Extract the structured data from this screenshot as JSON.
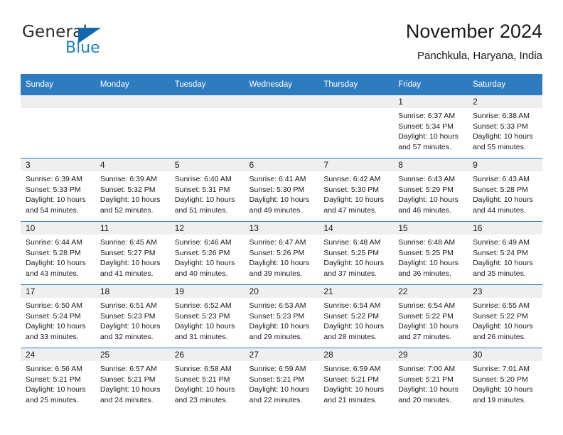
{
  "brand": {
    "name_part1": "General",
    "name_part2": "Blue",
    "accent_color": "#1f7fc4",
    "triangle_color": "#1168ad"
  },
  "header": {
    "title": "November 2024",
    "subtitle": "Panchkula, Haryana, India"
  },
  "theme": {
    "header_row_bg": "#2e7cbf",
    "daynum_bg": "#efefef",
    "cell_bg": "#ffffff",
    "text_color": "#1a1a1a"
  },
  "weekdays": [
    "Sunday",
    "Monday",
    "Tuesday",
    "Wednesday",
    "Thursday",
    "Friday",
    "Saturday"
  ],
  "labels": {
    "sunrise_prefix": "Sunrise: ",
    "sunset_prefix": "Sunset: ",
    "daylight_prefix": "Daylight: "
  },
  "weeks": [
    [
      {
        "day": "",
        "empty": true
      },
      {
        "day": "",
        "empty": true
      },
      {
        "day": "",
        "empty": true
      },
      {
        "day": "",
        "empty": true
      },
      {
        "day": "",
        "empty": true
      },
      {
        "day": "1",
        "sunrise": "Sunrise: 6:37 AM",
        "sunset": "Sunset: 5:34 PM",
        "daylight": "Daylight: 10 hours and 57 minutes."
      },
      {
        "day": "2",
        "sunrise": "Sunrise: 6:38 AM",
        "sunset": "Sunset: 5:33 PM",
        "daylight": "Daylight: 10 hours and 55 minutes."
      }
    ],
    [
      {
        "day": "3",
        "sunrise": "Sunrise: 6:39 AM",
        "sunset": "Sunset: 5:33 PM",
        "daylight": "Daylight: 10 hours and 54 minutes."
      },
      {
        "day": "4",
        "sunrise": "Sunrise: 6:39 AM",
        "sunset": "Sunset: 5:32 PM",
        "daylight": "Daylight: 10 hours and 52 minutes."
      },
      {
        "day": "5",
        "sunrise": "Sunrise: 6:40 AM",
        "sunset": "Sunset: 5:31 PM",
        "daylight": "Daylight: 10 hours and 51 minutes."
      },
      {
        "day": "6",
        "sunrise": "Sunrise: 6:41 AM",
        "sunset": "Sunset: 5:30 PM",
        "daylight": "Daylight: 10 hours and 49 minutes."
      },
      {
        "day": "7",
        "sunrise": "Sunrise: 6:42 AM",
        "sunset": "Sunset: 5:30 PM",
        "daylight": "Daylight: 10 hours and 47 minutes."
      },
      {
        "day": "8",
        "sunrise": "Sunrise: 6:43 AM",
        "sunset": "Sunset: 5:29 PM",
        "daylight": "Daylight: 10 hours and 46 minutes."
      },
      {
        "day": "9",
        "sunrise": "Sunrise: 6:43 AM",
        "sunset": "Sunset: 5:28 PM",
        "daylight": "Daylight: 10 hours and 44 minutes."
      }
    ],
    [
      {
        "day": "10",
        "sunrise": "Sunrise: 6:44 AM",
        "sunset": "Sunset: 5:28 PM",
        "daylight": "Daylight: 10 hours and 43 minutes."
      },
      {
        "day": "11",
        "sunrise": "Sunrise: 6:45 AM",
        "sunset": "Sunset: 5:27 PM",
        "daylight": "Daylight: 10 hours and 41 minutes."
      },
      {
        "day": "12",
        "sunrise": "Sunrise: 6:46 AM",
        "sunset": "Sunset: 5:26 PM",
        "daylight": "Daylight: 10 hours and 40 minutes."
      },
      {
        "day": "13",
        "sunrise": "Sunrise: 6:47 AM",
        "sunset": "Sunset: 5:26 PM",
        "daylight": "Daylight: 10 hours and 39 minutes."
      },
      {
        "day": "14",
        "sunrise": "Sunrise: 6:48 AM",
        "sunset": "Sunset: 5:25 PM",
        "daylight": "Daylight: 10 hours and 37 minutes."
      },
      {
        "day": "15",
        "sunrise": "Sunrise: 6:48 AM",
        "sunset": "Sunset: 5:25 PM",
        "daylight": "Daylight: 10 hours and 36 minutes."
      },
      {
        "day": "16",
        "sunrise": "Sunrise: 6:49 AM",
        "sunset": "Sunset: 5:24 PM",
        "daylight": "Daylight: 10 hours and 35 minutes."
      }
    ],
    [
      {
        "day": "17",
        "sunrise": "Sunrise: 6:50 AM",
        "sunset": "Sunset: 5:24 PM",
        "daylight": "Daylight: 10 hours and 33 minutes."
      },
      {
        "day": "18",
        "sunrise": "Sunrise: 6:51 AM",
        "sunset": "Sunset: 5:23 PM",
        "daylight": "Daylight: 10 hours and 32 minutes."
      },
      {
        "day": "19",
        "sunrise": "Sunrise: 6:52 AM",
        "sunset": "Sunset: 5:23 PM",
        "daylight": "Daylight: 10 hours and 31 minutes."
      },
      {
        "day": "20",
        "sunrise": "Sunrise: 6:53 AM",
        "sunset": "Sunset: 5:23 PM",
        "daylight": "Daylight: 10 hours and 29 minutes."
      },
      {
        "day": "21",
        "sunrise": "Sunrise: 6:54 AM",
        "sunset": "Sunset: 5:22 PM",
        "daylight": "Daylight: 10 hours and 28 minutes."
      },
      {
        "day": "22",
        "sunrise": "Sunrise: 6:54 AM",
        "sunset": "Sunset: 5:22 PM",
        "daylight": "Daylight: 10 hours and 27 minutes."
      },
      {
        "day": "23",
        "sunrise": "Sunrise: 6:55 AM",
        "sunset": "Sunset: 5:22 PM",
        "daylight": "Daylight: 10 hours and 26 minutes."
      }
    ],
    [
      {
        "day": "24",
        "sunrise": "Sunrise: 6:56 AM",
        "sunset": "Sunset: 5:21 PM",
        "daylight": "Daylight: 10 hours and 25 minutes."
      },
      {
        "day": "25",
        "sunrise": "Sunrise: 6:57 AM",
        "sunset": "Sunset: 5:21 PM",
        "daylight": "Daylight: 10 hours and 24 minutes."
      },
      {
        "day": "26",
        "sunrise": "Sunrise: 6:58 AM",
        "sunset": "Sunset: 5:21 PM",
        "daylight": "Daylight: 10 hours and 23 minutes."
      },
      {
        "day": "27",
        "sunrise": "Sunrise: 6:59 AM",
        "sunset": "Sunset: 5:21 PM",
        "daylight": "Daylight: 10 hours and 22 minutes."
      },
      {
        "day": "28",
        "sunrise": "Sunrise: 6:59 AM",
        "sunset": "Sunset: 5:21 PM",
        "daylight": "Daylight: 10 hours and 21 minutes."
      },
      {
        "day": "29",
        "sunrise": "Sunrise: 7:00 AM",
        "sunset": "Sunset: 5:21 PM",
        "daylight": "Daylight: 10 hours and 20 minutes."
      },
      {
        "day": "30",
        "sunrise": "Sunrise: 7:01 AM",
        "sunset": "Sunset: 5:20 PM",
        "daylight": "Daylight: 10 hours and 19 minutes."
      }
    ]
  ]
}
